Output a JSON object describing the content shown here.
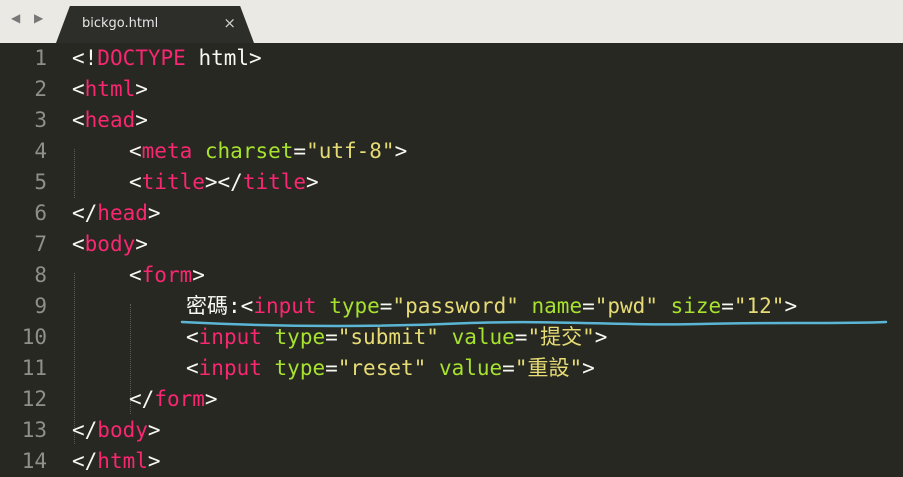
{
  "tab": {
    "filename": "bickgo.html",
    "close": "×",
    "nav": "◀ ▶"
  },
  "line_numbers": [
    "1",
    "2",
    "3",
    "4",
    "5",
    "6",
    "7",
    "8",
    "9",
    "10",
    "11",
    "12",
    "13",
    "14"
  ],
  "code": {
    "l1": {
      "lt": "<!",
      "tag": "DOCTYPE",
      "rest": " html",
      "gt": ">"
    },
    "l2": {
      "lt": "<",
      "tag": "html",
      "gt": ">"
    },
    "l3": {
      "lt": "<",
      "tag": "head",
      "gt": ">"
    },
    "l4": {
      "lt": "<",
      "tag": "meta",
      "attr": "charset",
      "eq": "=",
      "val": "\"utf-8\"",
      "gt": ">"
    },
    "l5": {
      "lt": "<",
      "tag": "title",
      "mid": "></",
      "tag2": "title",
      "gt": ">"
    },
    "l6": {
      "lt": "</",
      "tag": "head",
      "gt": ">"
    },
    "l7": {
      "lt": "<",
      "tag": "body",
      "gt": ">"
    },
    "l8": {
      "lt": "<",
      "tag": "form",
      "gt": ">"
    },
    "l9": {
      "text": "密碼:",
      "lt": "<",
      "tag": "input",
      "attr1": "type",
      "eq1": "=",
      "val1": "\"password\"",
      "attr2": "name",
      "eq2": "=",
      "val2": "\"pwd\"",
      "attr3": "size",
      "eq3": "=",
      "val3": "\"12\"",
      "gt": ">"
    },
    "l10": {
      "lt": "<",
      "tag": "input",
      "attr1": "type",
      "eq1": "=",
      "val1": "\"submit\"",
      "attr2": "value",
      "eq2": "=",
      "val2": "\"提交\"",
      "gt": ">"
    },
    "l11": {
      "lt": "<",
      "tag": "input",
      "attr1": "type",
      "eq1": "=",
      "val1": "\"reset\"",
      "attr2": "value",
      "eq2": "=",
      "val2": "\"重設\"",
      "gt": ">"
    },
    "l12": {
      "lt": "</",
      "tag": "form",
      "gt": ">"
    },
    "l13": {
      "lt": "</",
      "tag": "body",
      "gt": ">"
    },
    "l14": {
      "lt": "</",
      "tag": "html",
      "gt": ">"
    }
  },
  "colors": {
    "tag": "#f92672",
    "attr": "#a6e22e",
    "string": "#e6db74",
    "text": "#f8f8f2",
    "background": "#272822",
    "underline_annotation": "#5bb6d6"
  }
}
